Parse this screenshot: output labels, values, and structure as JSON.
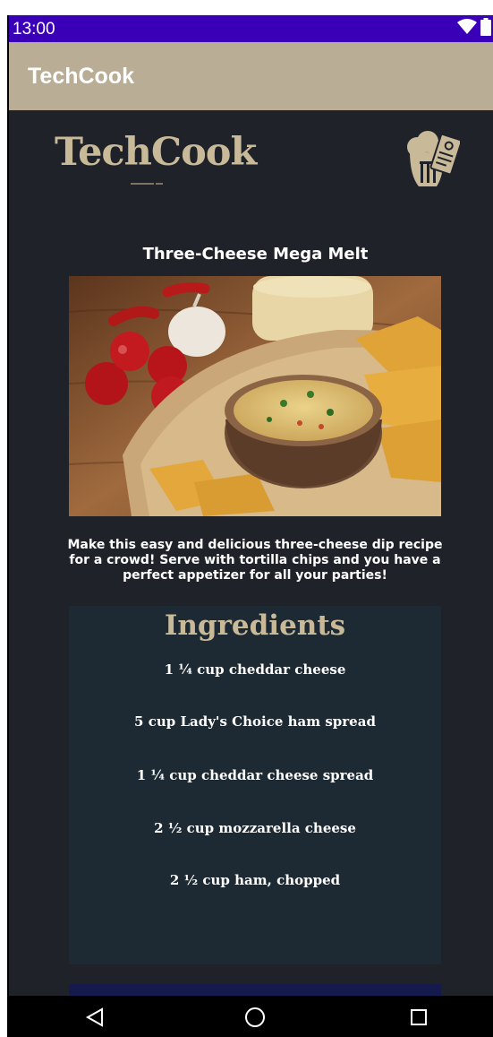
{
  "status_bar": {
    "time": "13:00",
    "icons": [
      "wifi-icon",
      "battery-icon"
    ]
  },
  "app_bar": {
    "title": "TechCook"
  },
  "brand": {
    "logo_text": "TechCook",
    "icon": "chef-hat-utensils-icon"
  },
  "recipe": {
    "title": "Three-Cheese Mega Melt",
    "image": "cheese-dip-with-tortilla-chips-photo",
    "description": "Make this easy and delicious three-cheese dip recipe for a crowd! Serve with tortilla chips and you have a perfect appetizer for all your parties!"
  },
  "ingredients": {
    "title": "Ingredients",
    "items": [
      "1 ¼ cup cheddar cheese",
      "5 cup Lady's Choice ham spread",
      "1 ¼ cup cheddar cheese spread",
      "2 ½ cup mozzarella cheese",
      "2 ½ cup ham, chopped"
    ]
  },
  "nav_bar": {
    "icons": [
      "back-icon",
      "home-icon",
      "recents-icon"
    ]
  },
  "colors": {
    "status_bar": "#3a00b8",
    "app_bar": "#b9ae95",
    "background": "#1f2229",
    "card": "#1d2a33",
    "accent_text": "#c8b999",
    "next_section": "#141a4c"
  }
}
